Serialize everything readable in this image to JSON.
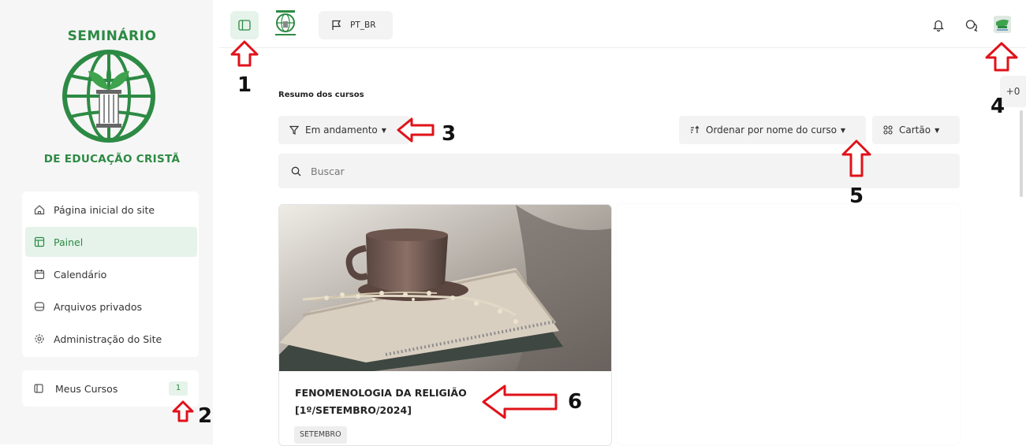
{
  "logo": {
    "top_text": "SEMINÁRIO",
    "bottom_text": "DE EDUCAÇÃO CRISTÃ"
  },
  "sidebar": {
    "items": [
      {
        "label": "Página inicial do site",
        "icon": "home-icon",
        "active": false
      },
      {
        "label": "Painel",
        "icon": "dashboard-icon",
        "active": true
      },
      {
        "label": "Calendário",
        "icon": "calendar-icon",
        "active": false
      },
      {
        "label": "Arquivos privados",
        "icon": "drive-icon",
        "active": false
      },
      {
        "label": "Administração do Site",
        "icon": "gear-icon",
        "active": false
      }
    ],
    "my_courses": {
      "label": "Meus Cursos",
      "count": "1"
    }
  },
  "topbar": {
    "language": "PT_BR",
    "peek_label": "+0"
  },
  "main": {
    "section_title": "Resumo dos cursos",
    "filter_label": "Em andamento",
    "sort_label": "Ordenar por nome do curso",
    "view_label": "Cartão",
    "search_placeholder": "Buscar"
  },
  "course": {
    "title_line1": "FENOMENOLOGIA DA RELIGIÃO",
    "title_line2": "[1º/SETEMBRO/2024]",
    "tag": "SETEMBRO"
  },
  "annotations": [
    "1",
    "2",
    "3",
    "4",
    "5",
    "6"
  ],
  "colors": {
    "brand_green": "#2d8a44",
    "active_bg": "#e5f3ea",
    "arrow_red": "#e0121a"
  }
}
